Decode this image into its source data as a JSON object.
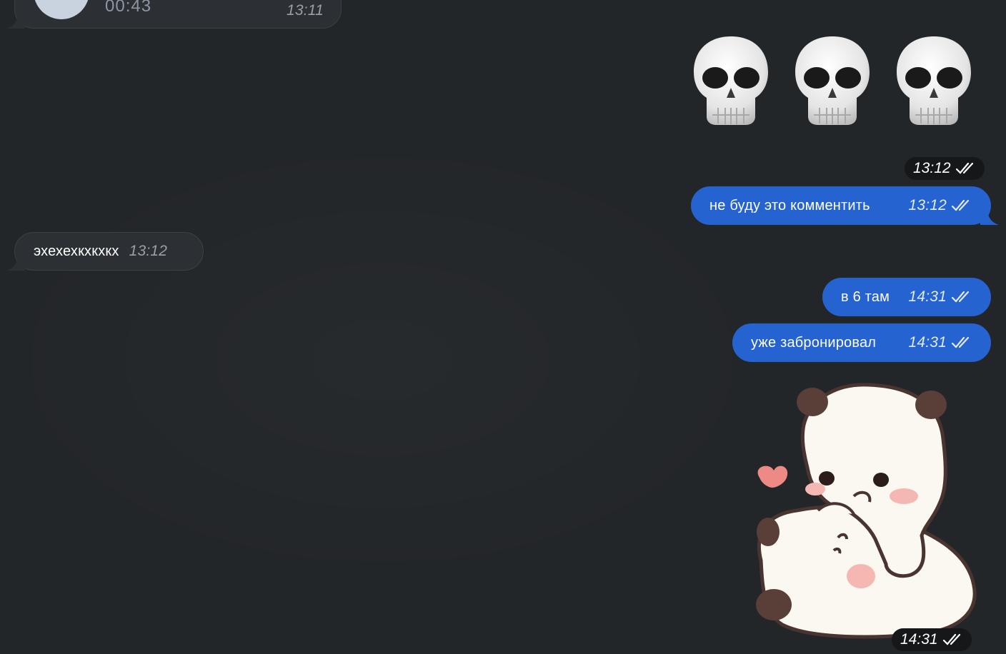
{
  "colors": {
    "background": "#232629",
    "incoming_bubble": "#2c2f33",
    "outgoing_bubble": "#2563d1",
    "time_pill": "#151719"
  },
  "voice_message": {
    "duration": "00:43",
    "time": "13:11",
    "icon": "voice-play-icon"
  },
  "emoji_message": {
    "emojis": [
      "💀",
      "💀",
      "💀"
    ],
    "time": "13:12",
    "status_icon": "double-check-icon"
  },
  "messages": [
    {
      "direction": "out",
      "text": "не буду это комментить",
      "time": "13:12",
      "status_icon": "double-check-icon"
    },
    {
      "direction": "in",
      "text": "эхехехкхкхкх",
      "time": "13:12"
    },
    {
      "direction": "out",
      "text": "в 6 там",
      "time": "14:31",
      "status_icon": "double-check-icon"
    },
    {
      "direction": "out",
      "text": "уже забронировал",
      "time": "14:31",
      "status_icon": "double-check-icon"
    }
  ],
  "sticker_message": {
    "description_icon": "panda-bears-sticker-icon",
    "time": "14:31",
    "status_icon": "double-check-icon"
  }
}
